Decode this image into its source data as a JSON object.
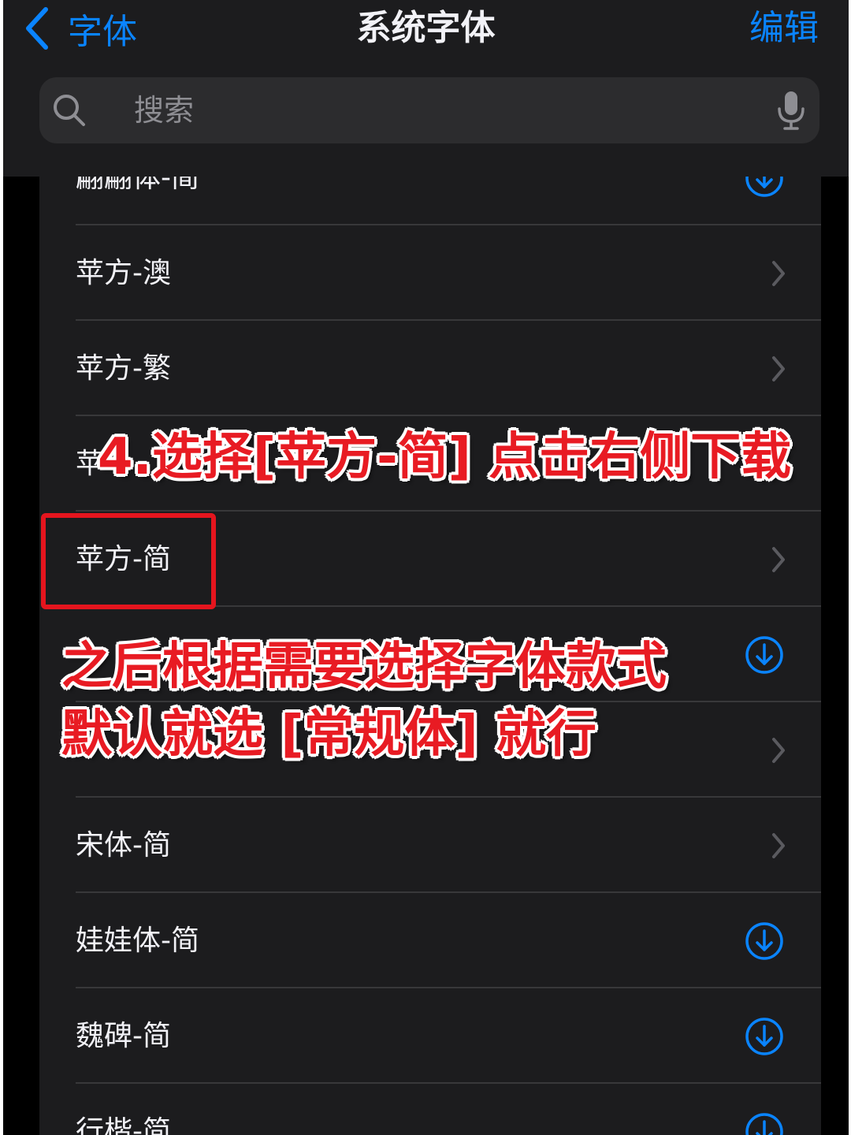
{
  "nav": {
    "back_label": "字体",
    "title": "系统字体",
    "edit_label": "编辑"
  },
  "search": {
    "placeholder": "搜索",
    "value": ""
  },
  "font_list": [
    {
      "label": "翩翩体-简",
      "action": "download"
    },
    {
      "label": "苹方-澳",
      "action": "chevron"
    },
    {
      "label": "苹方-繁",
      "action": "chevron"
    },
    {
      "label": "苹",
      "action": "none"
    },
    {
      "label": "苹方-简",
      "action": "chevron"
    },
    {
      "label": "",
      "action": "download"
    },
    {
      "label": "",
      "action": "chevron"
    },
    {
      "label": "宋体-简",
      "action": "chevron"
    },
    {
      "label": "娃娃体-简",
      "action": "download"
    },
    {
      "label": "魏碑-简",
      "action": "download"
    },
    {
      "label": "行楷-简",
      "action": "download"
    }
  ],
  "annotations": {
    "step": "4.选择[苹方-简] 点击右侧下载",
    "line1": "之后根据需要选择字体款式",
    "line2": "默认就选 [常规体] 就行"
  },
  "colors": {
    "accent": "#0a84ff",
    "annotation": "#e81b23",
    "background": "#000000",
    "cell": "#1c1c1e"
  },
  "icons": {
    "back": "chevron-left-icon",
    "search": "search-icon",
    "mic": "microphone-icon",
    "row_chevron": "chevron-right-icon",
    "row_download": "download-icon"
  }
}
